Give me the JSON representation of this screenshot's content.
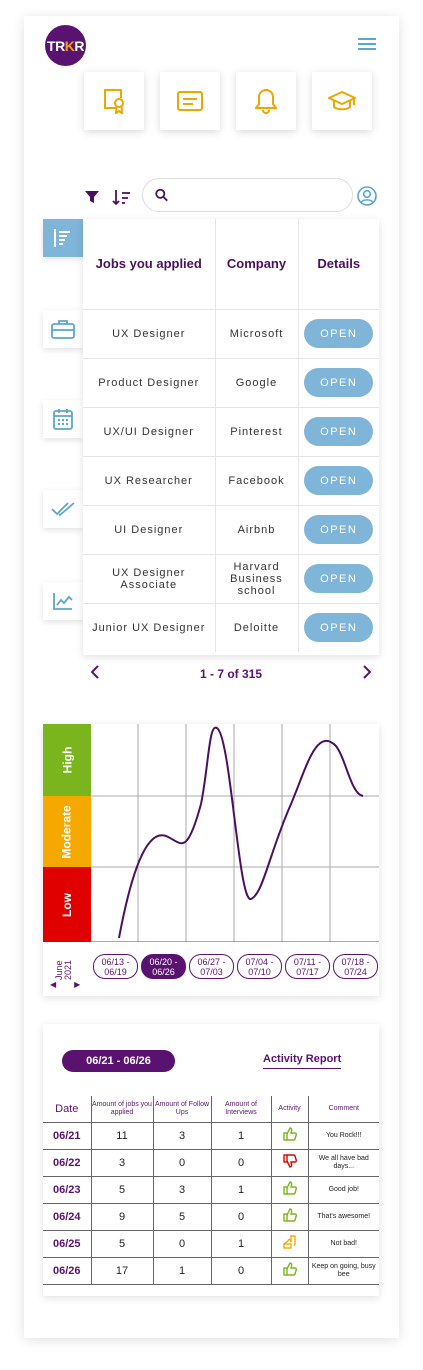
{
  "header": {
    "logo_left": "TR",
    "logo_mid": "K",
    "logo_right": "R",
    "menu_icon": "hamburger-icon",
    "tiles": [
      "certificate-icon",
      "message-icon",
      "bell-icon",
      "graduation-cap-icon"
    ]
  },
  "search": {
    "placeholder": "",
    "value": ""
  },
  "side_nav": [
    "bar-list-icon",
    "briefcase-icon",
    "calendar-icon",
    "double-check-icon",
    "line-chart-icon"
  ],
  "jobs_table": {
    "headers": [
      "Jobs you applied",
      "Company",
      "Details"
    ],
    "rows": [
      {
        "job": "UX Designer",
        "company": "Microsoft",
        "action": "OPEN"
      },
      {
        "job": "Product Designer",
        "company": "Google",
        "action": "OPEN"
      },
      {
        "job": "UX/UI Designer",
        "company": "Pinterest",
        "action": "OPEN"
      },
      {
        "job": "UX Researcher",
        "company": "Facebook",
        "action": "OPEN"
      },
      {
        "job": "UI Designer",
        "company": "Airbnb",
        "action": "OPEN"
      },
      {
        "job": "UX Designer Associate",
        "company": "Harvard Business school",
        "action": "OPEN"
      },
      {
        "job": "Junior UX Designer",
        "company": "Deloitte",
        "action": "OPEN"
      }
    ],
    "pagination": "1 - 7 of 315"
  },
  "mood_chart": {
    "bands": [
      {
        "label": "High",
        "color": "#7ab51d"
      },
      {
        "label": "Moderate",
        "color": "#f5a800"
      },
      {
        "label": "Low",
        "color": "#e00000"
      }
    ],
    "month_label": "June",
    "year_label": "2021",
    "weeks": [
      "06/13 - 06/19",
      "06/20 - 06/26",
      "06/27 - 07/03",
      "07/04 - 07/10",
      "07/11 - 07/17",
      "07/18 - 07/24"
    ],
    "selected_week": 1,
    "curve_color": "#4a1060"
  },
  "activity": {
    "range": "06/21 - 06/26",
    "report_link": "Activity Report",
    "headers": [
      "Date",
      "Amount of jobs you applied",
      "Amount of Follow Ups",
      "Amount of Interviews",
      "Activity",
      "Comment"
    ],
    "rows": [
      {
        "date": "06/21",
        "jobs": "11",
        "followups": "3",
        "interviews": "1",
        "activity": "thumbs-up",
        "comment": "You Rock!!!"
      },
      {
        "date": "06/22",
        "jobs": "3",
        "followups": "0",
        "interviews": "0",
        "activity": "thumbs-down",
        "comment": "We all have bad days..."
      },
      {
        "date": "06/23",
        "jobs": "5",
        "followups": "3",
        "interviews": "1",
        "activity": "thumbs-up",
        "comment": "Good job!"
      },
      {
        "date": "06/24",
        "jobs": "9",
        "followups": "5",
        "interviews": "0",
        "activity": "thumbs-up",
        "comment": "That's awesome!"
      },
      {
        "date": "06/25",
        "jobs": "5",
        "followups": "0",
        "interviews": "1",
        "activity": "thumbs-side",
        "comment": "Not bad!"
      },
      {
        "date": "06/26",
        "jobs": "17",
        "followups": "1",
        "interviews": "0",
        "activity": "thumbs-up",
        "comment": "Keep on going, busy bee"
      }
    ]
  },
  "colors": {
    "brand": "#5a1270",
    "accent": "#7fb5d8",
    "icon_orange": "#f0a500",
    "thumb_green": "#7ab51d",
    "thumb_red": "#e00000",
    "thumb_orange": "#f5a800"
  }
}
